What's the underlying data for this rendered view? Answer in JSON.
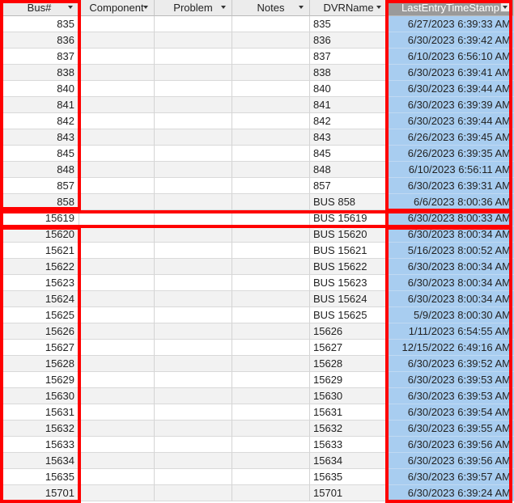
{
  "columns": [
    {
      "key": "bus",
      "label": "Bus#"
    },
    {
      "key": "component",
      "label": "Component"
    },
    {
      "key": "problem",
      "label": "Problem"
    },
    {
      "key": "notes",
      "label": "Notes"
    },
    {
      "key": "dvr",
      "label": "DVRName"
    },
    {
      "key": "ts",
      "label": "LastEntryTimeStamp"
    }
  ],
  "rows": [
    {
      "bus": "835",
      "dvr": "835",
      "ts": "6/27/2023 6:39:33 AM"
    },
    {
      "bus": "836",
      "dvr": "836",
      "ts": "6/30/2023 6:39:42 AM"
    },
    {
      "bus": "837",
      "dvr": "837",
      "ts": "6/10/2023 6:56:10 AM"
    },
    {
      "bus": "838",
      "dvr": "838",
      "ts": "6/30/2023 6:39:41 AM"
    },
    {
      "bus": "840",
      "dvr": "840",
      "ts": "6/30/2023 6:39:44 AM"
    },
    {
      "bus": "841",
      "dvr": "841",
      "ts": "6/30/2023 6:39:39 AM"
    },
    {
      "bus": "842",
      "dvr": "842",
      "ts": "6/30/2023 6:39:44 AM"
    },
    {
      "bus": "843",
      "dvr": "843",
      "ts": "6/26/2023 6:39:45 AM"
    },
    {
      "bus": "845",
      "dvr": "845",
      "ts": "6/26/2023 6:39:35 AM"
    },
    {
      "bus": "848",
      "dvr": "848",
      "ts": "6/10/2023 6:56:11 AM"
    },
    {
      "bus": "857",
      "dvr": "857",
      "ts": "6/30/2023 6:39:31 AM"
    },
    {
      "bus": "858",
      "dvr": "BUS 858",
      "ts": "6/6/2023 8:00:36 AM"
    },
    {
      "bus": "15619",
      "dvr": "BUS 15619",
      "ts": "6/30/2023 8:00:33 AM"
    },
    {
      "bus": "15620",
      "dvr": "BUS 15620",
      "ts": "6/30/2023 8:00:34 AM"
    },
    {
      "bus": "15621",
      "dvr": "BUS 15621",
      "ts": "5/16/2023 8:00:52 AM"
    },
    {
      "bus": "15622",
      "dvr": "BUS 15622",
      "ts": "6/30/2023 8:00:34 AM"
    },
    {
      "bus": "15623",
      "dvr": "BUS 15623",
      "ts": "6/30/2023 8:00:34 AM"
    },
    {
      "bus": "15624",
      "dvr": "BUS 15624",
      "ts": "6/30/2023 8:00:34 AM"
    },
    {
      "bus": "15625",
      "dvr": "BUS 15625",
      "ts": "5/9/2023 8:00:30 AM"
    },
    {
      "bus": "15626",
      "dvr": "15626",
      "ts": "1/11/2023 6:54:55 AM"
    },
    {
      "bus": "15627",
      "dvr": "15627",
      "ts": "12/15/2022 6:49:16 AM"
    },
    {
      "bus": "15628",
      "dvr": "15628",
      "ts": "6/30/2023 6:39:52 AM"
    },
    {
      "bus": "15629",
      "dvr": "15629",
      "ts": "6/30/2023 6:39:53 AM"
    },
    {
      "bus": "15630",
      "dvr": "15630",
      "ts": "6/30/2023 6:39:53 AM"
    },
    {
      "bus": "15631",
      "dvr": "15631",
      "ts": "6/30/2023 6:39:54 AM"
    },
    {
      "bus": "15632",
      "dvr": "15632",
      "ts": "6/30/2023 6:39:55 AM"
    },
    {
      "bus": "15633",
      "dvr": "15633",
      "ts": "6/30/2023 6:39:56 AM"
    },
    {
      "bus": "15634",
      "dvr": "15634",
      "ts": "6/30/2023 6:39:56 AM"
    },
    {
      "bus": "15635",
      "dvr": "15635",
      "ts": "6/30/2023 6:39:57 AM"
    },
    {
      "bus": "15701",
      "dvr": "15701",
      "ts": "6/30/2023 6:39:24 AM"
    }
  ],
  "highlight_color": "#ff0000",
  "selected_column_color": "#a8cdf0",
  "icons": {
    "header_dropdown": "chevron-down-icon"
  }
}
